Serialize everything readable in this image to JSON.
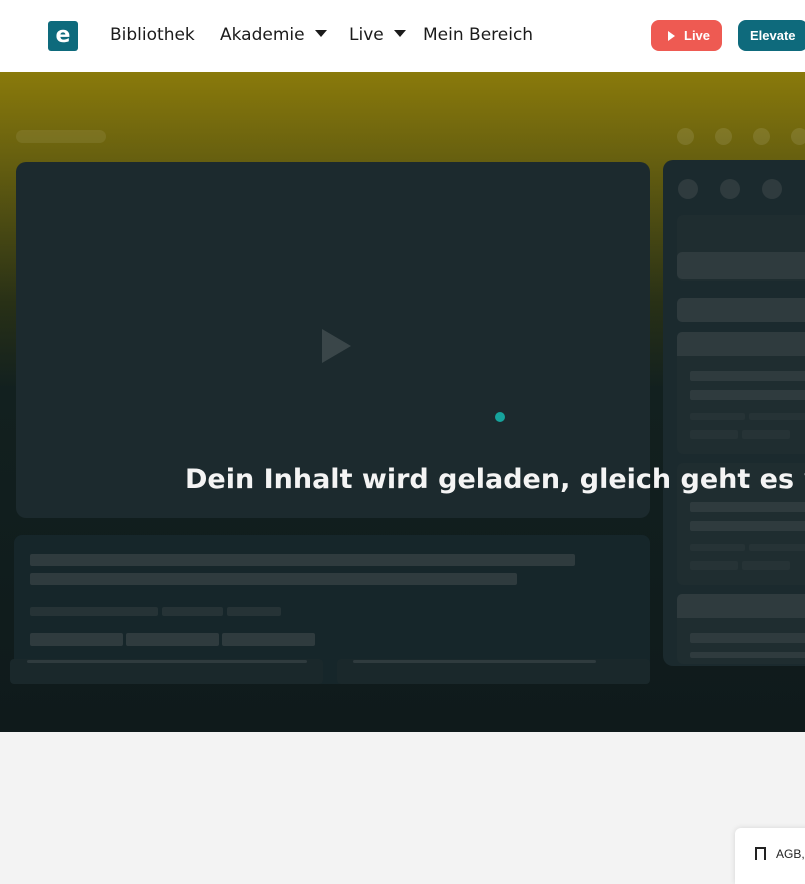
{
  "nav": {
    "logo_letter": "e",
    "items": [
      {
        "label": "Bibliothek"
      },
      {
        "label": "Akademie"
      },
      {
        "label": "Live"
      },
      {
        "label": "Mein Bereich"
      }
    ],
    "live_button": "Live",
    "elevate_button": "Elevate"
  },
  "hero": {
    "loading_text": "Dein Inhalt wird geladen, gleich geht es weiter"
  },
  "footer": {
    "tab_text": "AGB,"
  },
  "colors": {
    "brand": "#0e6a7c",
    "live": "#ee5a52",
    "spinner": "#16a39c"
  }
}
